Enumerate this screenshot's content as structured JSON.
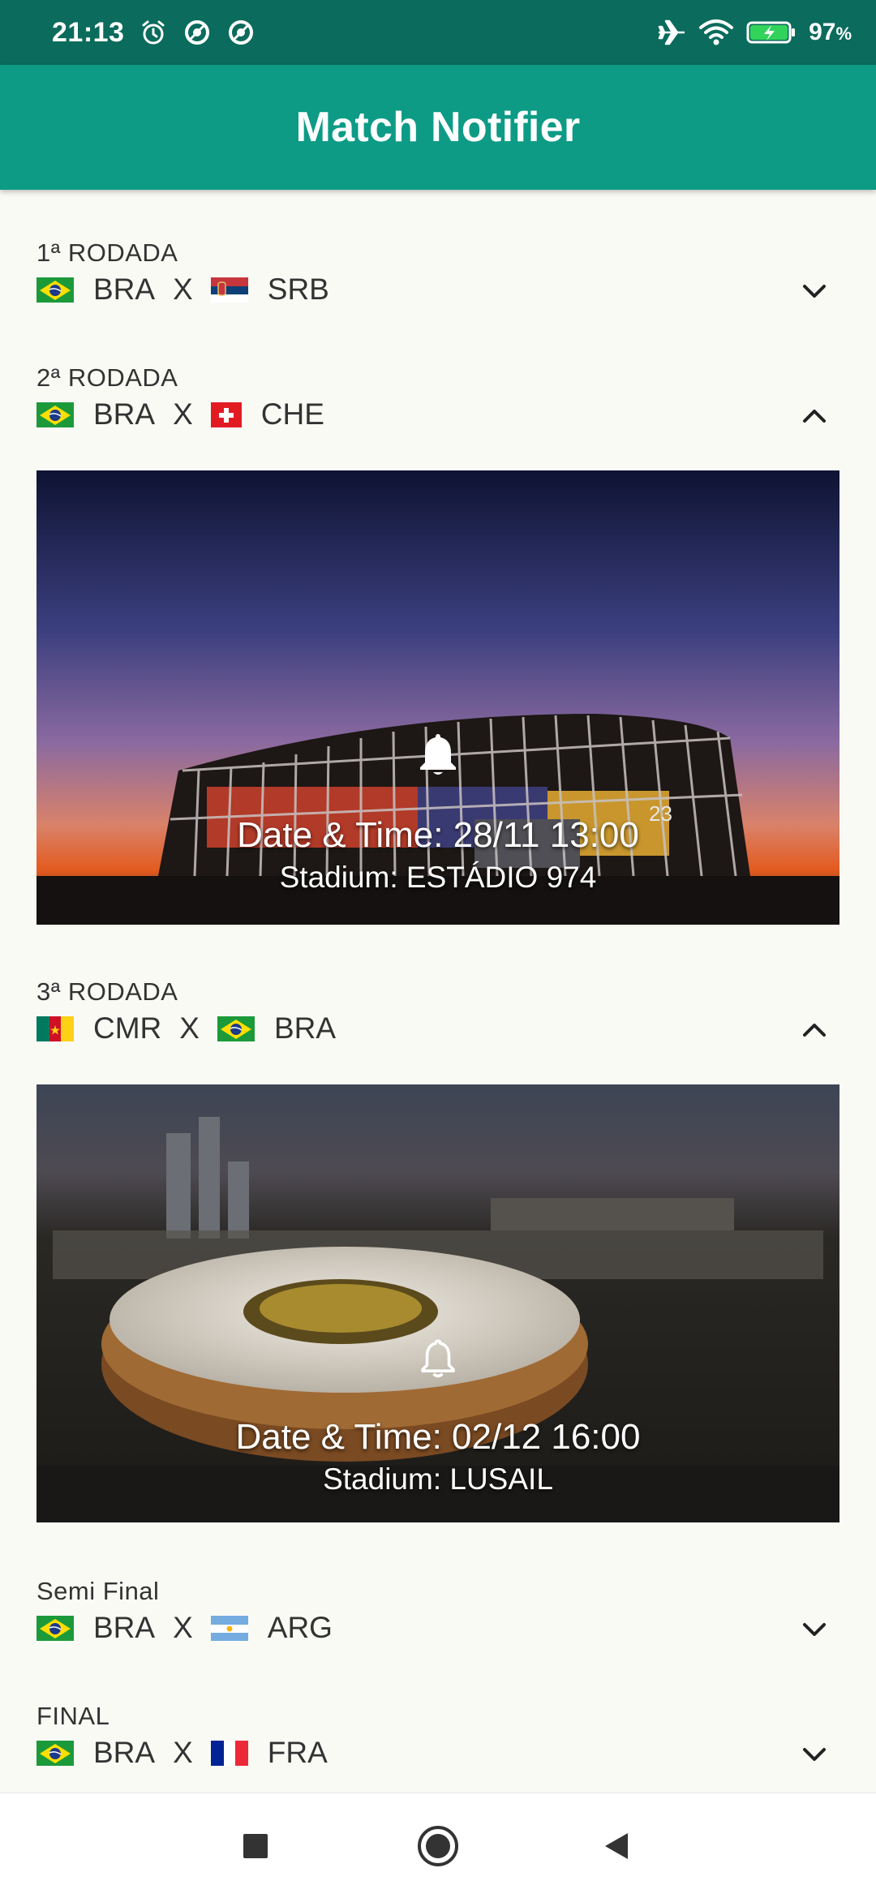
{
  "status_bar": {
    "time": "21:13",
    "battery_percent": "97",
    "battery_unit": "%",
    "icons": [
      "alarm-icon",
      "data-saver-icon",
      "data-saver-icon",
      "airplane-icon",
      "wifi-icon",
      "battery-charging-icon"
    ]
  },
  "app_bar": {
    "title": "Match Notifier",
    "color": "#0d9b86"
  },
  "matches": [
    {
      "round": "1ª RODADA",
      "home": "BRA",
      "vs": "X",
      "away": "SRB",
      "expanded": false,
      "home_flag": "brazil",
      "away_flag": "serbia"
    },
    {
      "round": "2ª RODADA",
      "home": "BRA",
      "vs": "X",
      "away": "CHE",
      "expanded": true,
      "home_flag": "brazil",
      "away_flag": "switzerland",
      "datetime": "Date & Time: 28/11 13:00",
      "stadium": "Stadium: ESTÁDIO 974",
      "notify": true,
      "stadium_sign": "23"
    },
    {
      "round": "3ª RODADA",
      "home": "CMR",
      "vs": "X",
      "away": "BRA",
      "expanded": true,
      "home_flag": "cameroon",
      "away_flag": "brazil",
      "datetime": "Date & Time: 02/12 16:00",
      "stadium": "Stadium: LUSAIL",
      "notify": false
    },
    {
      "round": "Semi Final",
      "home": "BRA",
      "vs": "X",
      "away": "ARG",
      "expanded": false,
      "home_flag": "brazil",
      "away_flag": "argentina"
    },
    {
      "round": "FINAL",
      "home": "BRA",
      "vs": "X",
      "away": "FRA",
      "expanded": false,
      "home_flag": "brazil",
      "away_flag": "france"
    }
  ],
  "nav_bar": {
    "buttons": [
      "recents-square-icon",
      "home-circle-icon",
      "back-triangle-icon"
    ]
  }
}
